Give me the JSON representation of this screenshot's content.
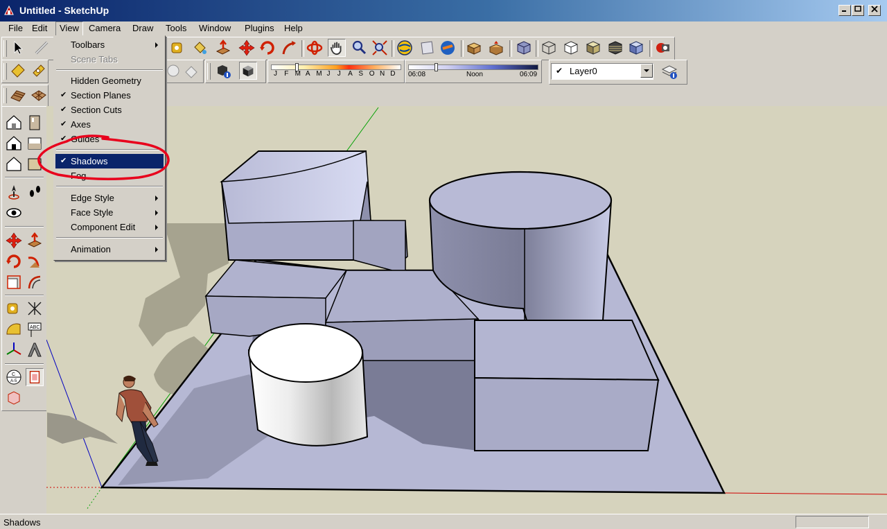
{
  "window": {
    "title": "Untitled - SketchUp",
    "controls": [
      "minimize",
      "maximize",
      "close"
    ]
  },
  "menubar": [
    "File",
    "Edit",
    "View",
    "Camera",
    "Draw",
    "Tools",
    "Window",
    "Plugins",
    "Help"
  ],
  "view_menu": {
    "items": [
      {
        "label": "Toolbars",
        "submenu": true
      },
      {
        "label": "Scene Tabs",
        "disabled": true
      },
      {
        "label": "Hidden Geometry"
      },
      {
        "label": "Section Planes",
        "checked": true
      },
      {
        "label": "Section Cuts",
        "checked": true
      },
      {
        "label": "Axes",
        "checked": true
      },
      {
        "label": "Guides",
        "checked": true
      },
      {
        "label": "Shadows",
        "checked": true,
        "highlighted": true
      },
      {
        "label": "Fog"
      },
      {
        "label": "Edge Style",
        "submenu": true
      },
      {
        "label": "Face Style",
        "submenu": true
      },
      {
        "label": "Component Edit",
        "submenu": true
      },
      {
        "label": "Animation",
        "submenu": true
      }
    ],
    "check_glyph": "✔",
    "annotation": "red-circle-around-shadows"
  },
  "shadow_settings": {
    "months": [
      "J",
      "F",
      "M",
      "A",
      "M",
      "J",
      "J",
      "A",
      "S",
      "O",
      "N",
      "D"
    ],
    "selected_month": "M",
    "time_start": "06:08",
    "time_mid": "Noon",
    "time_end": "06:09"
  },
  "layers": {
    "current": "Layer0",
    "visible_check": "✔"
  },
  "statusbar": {
    "text": "Shadows",
    "measurements": ""
  },
  "colors": {
    "title_gradient_start": "#0a246a",
    "title_gradient_end": "#a6caf0",
    "highlight": "#0a246a",
    "viewport_background": "#d6d3bd",
    "annotation_red": "#e8001c",
    "model_face": "#b8bbd8"
  },
  "icons": {
    "toolbar_main": [
      "select-icon",
      "line-icon",
      "tape-measure-icon",
      "paint-bucket-icon",
      "push-pull-icon",
      "move-icon",
      "rotate-icon",
      "follow-me-icon",
      "orbit-icon",
      "pan-icon",
      "zoom-icon",
      "zoom-extents-icon",
      "earth-icon",
      "photo-texture-icon",
      "warehouse-icon",
      "components-icon",
      "share-icon",
      "xray-icon",
      "wireframe-icon",
      "hidden-line-icon",
      "shaded-icon",
      "textured-icon",
      "monochrome-icon",
      "extension-icon"
    ],
    "left_toolbar": [
      "iso-view-icon",
      "front-view-icon",
      "top-view-icon",
      "right-view-icon",
      "back-view-icon",
      "left-view-icon",
      "position-camera-icon",
      "walk-icon",
      "look-around-icon",
      "move-tool-icon",
      "push-pull-tool-icon",
      "rotate-tool-icon",
      "follow-me-tool-icon",
      "scale-icon",
      "offset-icon",
      "tape-icon",
      "dimension-icon",
      "protractor-icon",
      "text-icon",
      "axes-tool-icon",
      "3d-text-icon",
      "section-plane-icon",
      "section-display-icon",
      "section-fill-icon"
    ]
  }
}
